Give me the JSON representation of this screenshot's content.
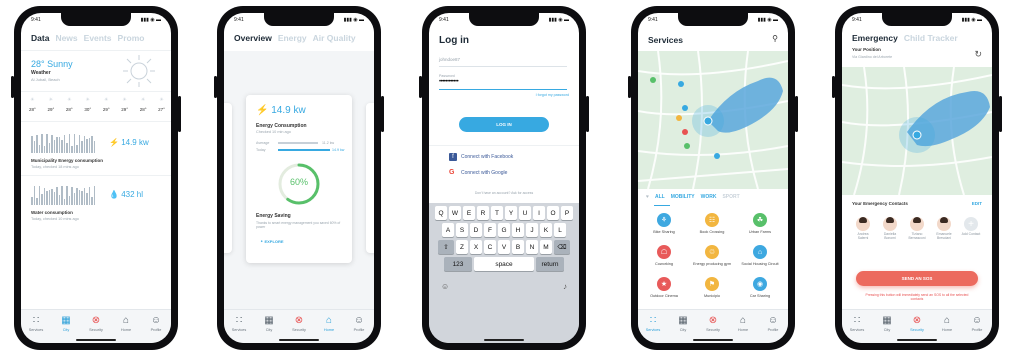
{
  "status": {
    "time": "9:41",
    "signal": "▮▮▮ ◉ ▬"
  },
  "nav": [
    {
      "label": "Services",
      "icon": "grid-icon",
      "glyph": "∷"
    },
    {
      "label": "City",
      "icon": "city-icon",
      "glyph": "▦"
    },
    {
      "label": "Security",
      "icon": "security-icon",
      "glyph": "⊗"
    },
    {
      "label": "Home",
      "icon": "home-icon",
      "glyph": "⌂"
    },
    {
      "label": "Profile",
      "icon": "profile-icon",
      "glyph": "☺"
    }
  ],
  "data_screen": {
    "tabs": [
      "Data",
      "News",
      "Events",
      "Promo"
    ],
    "weather_temp": "28° Sunny",
    "weather_label": "Weather",
    "weather_loc": "Al Jubail, Beach",
    "forecast_temps": [
      "28°",
      "29°",
      "28°",
      "30°",
      "29°",
      "29°",
      "28°",
      "27°"
    ],
    "energy_value": "14.9 kw",
    "energy_title": "Municipality Energy consumption",
    "energy_sub": "Today, checked 18 mins ago",
    "water_value": "432 hl",
    "water_title": "Water consumption",
    "water_sub": "Today, checked 10 mins ago"
  },
  "overview_screen": {
    "tabs": [
      "Overview",
      "Energy",
      "Air Quality"
    ],
    "value": "14.9 kw",
    "title": "Energy Consumption",
    "sub": "Checked 10 min ago",
    "avg_label": "Average",
    "avg_val": "11.2 kw",
    "today_label": "Today",
    "today_val": "14.9 kw",
    "saving_pct": "60%",
    "saving_fraction": 0.6,
    "saving_title": "Energy Saving",
    "saving_text": "Thanks to smart energy management you saved 60% of power",
    "explore": "EXPLORE"
  },
  "login_screen": {
    "title": "Log in",
    "username": "johndoe87",
    "password_label": "Password",
    "password": "••••••••••••",
    "forgot": "I forgot my password",
    "login_btn": "LOG IN",
    "facebook": "Connect with Facebook",
    "google": "Connect with Google",
    "no_account": "Don't have an account? Ask for access",
    "keys_row1": [
      "Q",
      "W",
      "E",
      "R",
      "T",
      "Y",
      "U",
      "I",
      "O",
      "P"
    ],
    "keys_row2": [
      "A",
      "S",
      "D",
      "F",
      "G",
      "H",
      "J",
      "K",
      "L"
    ],
    "keys_row3": [
      "Z",
      "X",
      "C",
      "V",
      "B",
      "N",
      "M"
    ],
    "key_123": "123",
    "key_space": "space",
    "key_return": "return"
  },
  "services_screen": {
    "title": "Services",
    "filters": [
      "ALL",
      "MOBILITY",
      "WORK",
      "SPORT"
    ],
    "items": [
      {
        "label": "Bike Sharing",
        "color": "#3ea8e0"
      },
      {
        "label": "Book Crossing",
        "color": "#f2b640"
      },
      {
        "label": "Urban Farms",
        "color": "#58c06a"
      },
      {
        "label": "Coworking",
        "color": "#e85a5a"
      },
      {
        "label": "Energy producing gym",
        "color": "#f2b640"
      },
      {
        "label": "Social Housing Circuit",
        "color": "#3ea8e0"
      },
      {
        "label": "Outdoor Cinema",
        "color": "#e85a5a"
      },
      {
        "label": "Municipio",
        "color": "#f2b640"
      },
      {
        "label": "Car Sharing",
        "color": "#3ea8e0"
      }
    ]
  },
  "emergency_screen": {
    "tabs": [
      "Emergency",
      "Child Tracker"
    ],
    "position_label": "Your Position",
    "position_sub": "Via Giardino del Arborete",
    "contacts_title": "Your Emergency Contacts",
    "edit": "EDIT",
    "contacts": [
      "Andrea Salerni",
      "Daniella Bonomi",
      "Tiziano Bernasconi",
      "Emanuele Bresciani",
      "Add Contact"
    ],
    "sos_btn": "SEND AN SOS",
    "sos_note": "Pressing this button will immediately send an SOS to all the selected contacts"
  },
  "colors": {
    "accent": "#37a9e1",
    "danger": "#e85252",
    "green": "#58c06a"
  }
}
